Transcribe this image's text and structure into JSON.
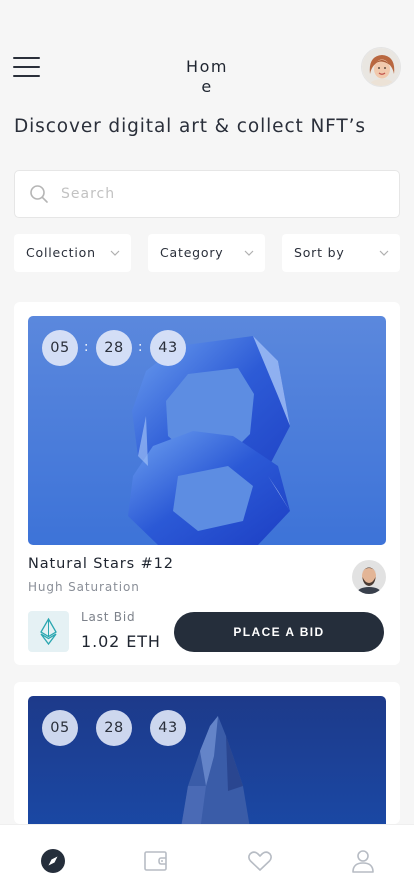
{
  "header": {
    "title": "Home",
    "menu_icon": "hamburger-menu-icon",
    "avatar_icon": "user-avatar"
  },
  "headline": "Discover digital art & collect NFT’s",
  "search": {
    "placeholder": "Search",
    "value": "",
    "icon": "search-icon"
  },
  "filters": [
    {
      "label": "Collection"
    },
    {
      "label": "Category"
    },
    {
      "label": "Sort by"
    }
  ],
  "cards": [
    {
      "timer": {
        "hours": "05",
        "minutes": "28",
        "seconds": "43",
        "separator": ":"
      },
      "name": "Natural Stars #12",
      "creator": "Hugh Saturation",
      "last_bid_label": "Last Bid",
      "last_bid_value": "1.02 ETH",
      "currency_icon": "ethereum-icon",
      "button_label": "PLACE A BID"
    },
    {
      "timer": {
        "hours": "05",
        "minutes": "28",
        "seconds": "43"
      }
    }
  ],
  "tabbar": {
    "items": [
      {
        "icon": "compass-icon",
        "active": true
      },
      {
        "icon": "wallet-icon",
        "active": false
      },
      {
        "icon": "heart-icon",
        "active": false
      },
      {
        "icon": "profile-icon",
        "active": false
      }
    ]
  },
  "colors": {
    "background": "#f6f6f6",
    "dark": "#252e3b",
    "card": "#ffffff",
    "art_blue": "#3e78dc",
    "eth_teal": "#2aa6b0"
  }
}
